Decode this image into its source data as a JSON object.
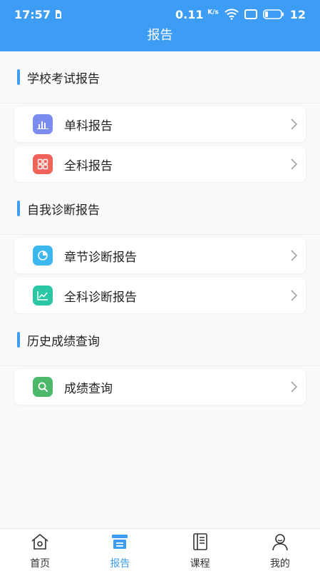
{
  "status_bar": {
    "time": "17:57",
    "speed_value": "0.11",
    "speed_unit": "K/s",
    "battery": "12"
  },
  "header": {
    "title": "报告"
  },
  "sections": [
    {
      "title": "学校考试报告",
      "items": [
        {
          "label": "单科报告",
          "icon": "bar-chart-icon",
          "color": "#7a8cf0"
        },
        {
          "label": "全科报告",
          "icon": "grid-icon",
          "color": "#f0625a"
        }
      ]
    },
    {
      "title": "自我诊断报告",
      "items": [
        {
          "label": "章节诊断报告",
          "icon": "pie-chart-icon",
          "color": "#3db8ef"
        },
        {
          "label": "全科诊断报告",
          "icon": "line-chart-icon",
          "color": "#2bc7a4"
        }
      ]
    },
    {
      "title": "历史成绩查询",
      "items": [
        {
          "label": "成绩查询",
          "icon": "search-icon",
          "color": "#4cb86a"
        }
      ]
    }
  ],
  "tabbar": {
    "tabs": [
      {
        "label": "首页",
        "icon": "home-icon"
      },
      {
        "label": "报告",
        "icon": "report-icon",
        "active": true
      },
      {
        "label": "课程",
        "icon": "course-icon"
      },
      {
        "label": "我的",
        "icon": "profile-icon"
      }
    ],
    "accent": "#3d9cf4"
  }
}
